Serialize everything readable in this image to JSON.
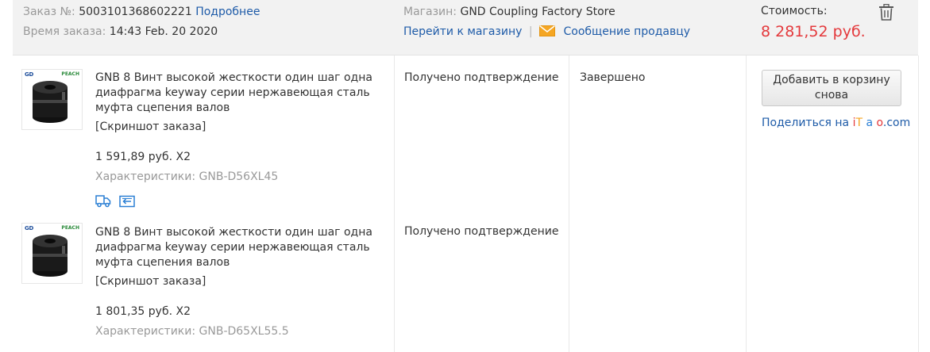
{
  "order": {
    "number_label": "Заказ №:",
    "number": "5003101368602221",
    "details_link": "Подробнее",
    "time_label": "Время заказа:",
    "time": "14:43 Feb. 20 2020",
    "store_label": "Магазин:",
    "store_name": "GND Coupling Factory Store",
    "go_to_store": "Перейти к магазину",
    "separator": "|",
    "message_seller": "Сообщение продавцу",
    "cost_label": "Стоимость:",
    "cost_value": "8 281,52 руб."
  },
  "items": [
    {
      "title": "GNB 8 Винт высокой жесткости один шаг одна диафрагма keyway серии нержавеющая сталь муфта сцепения валов",
      "snapshot": "[Скриншот заказа]",
      "price": "1 591,89 руб. X2",
      "specs": "Характеристики: GNB-D56XL45",
      "status": "Получено подтверждение",
      "thumb_brand": "GD",
      "thumb_brand2": "PEACH"
    },
    {
      "title": "GNB 8 Винт высокой жесткости один шаг одна диафрагма keyway серии нержавеющая сталь муфта сцепения валов",
      "snapshot": "[Скриншот заказа]",
      "price": "1 801,35 руб. X2",
      "specs": "Характеристики: GNB-D65XL55.5",
      "status": "Получено подтверждение",
      "thumb_brand": "GD",
      "thumb_brand2": "PEACH"
    }
  ],
  "order_status": "Завершено",
  "actions": {
    "add_to_cart": "Добавить в корзину снова",
    "share_prefix": "Поделиться на ",
    "share_i": "i",
    "share_t": "T",
    "share_a": "a",
    "share_o": "o",
    "share_com": ".com"
  },
  "colors": {
    "header_bg": "#f2f2f2",
    "link": "#1e5ba8",
    "price_red": "#e4393c",
    "envelope": "#f5a623",
    "service_icon": "#2a7fd4"
  }
}
